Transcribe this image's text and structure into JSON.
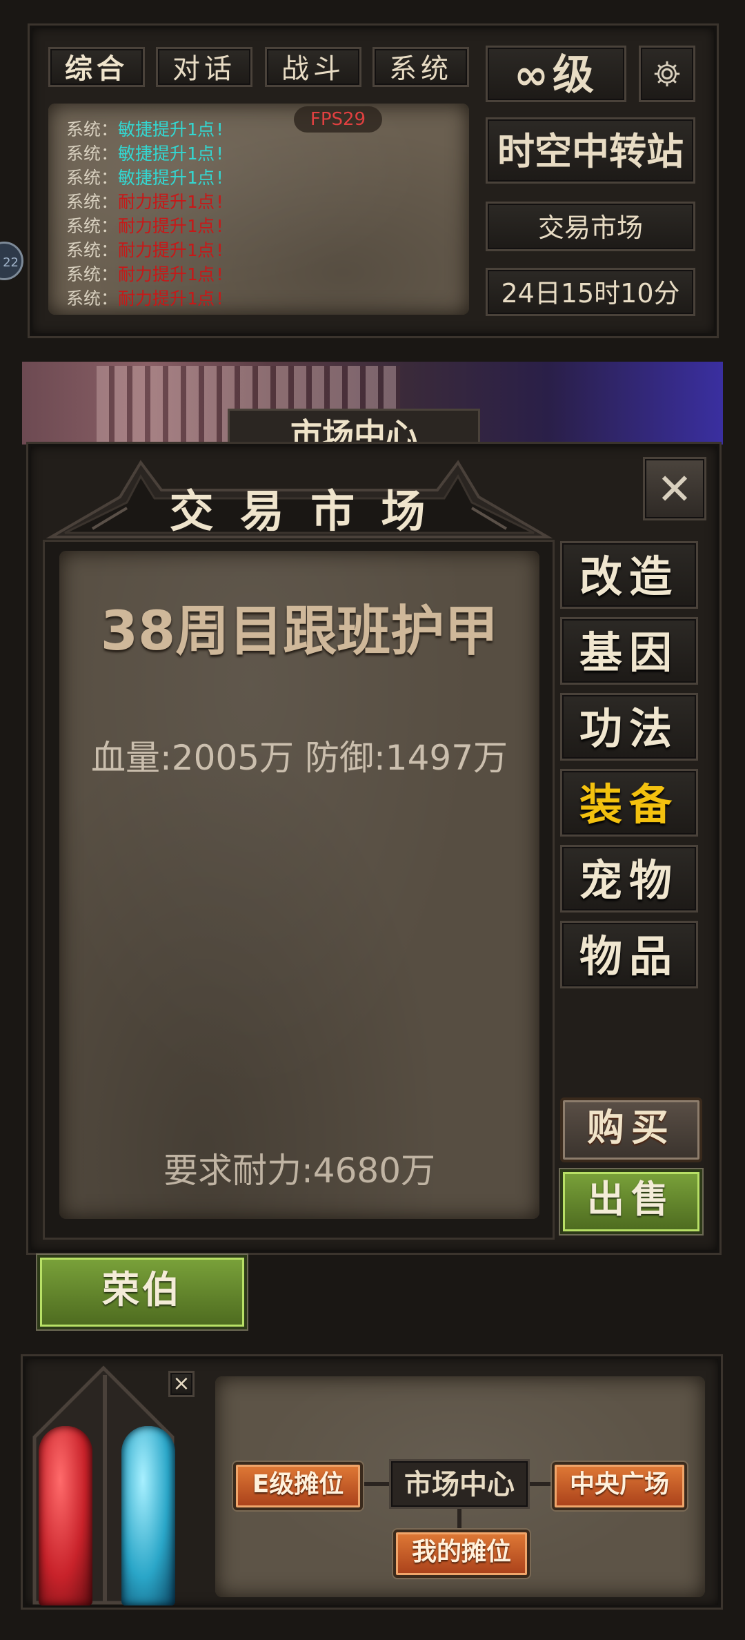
{
  "top_tabs": [
    "综合",
    "对话",
    "战斗",
    "系统"
  ],
  "level_label": "∞级",
  "fps": "FPS29",
  "chat_lines": [
    {
      "prefix": "系统：",
      "text": "敏捷提升1点!",
      "color": "cyan"
    },
    {
      "prefix": "系统：",
      "text": "敏捷提升1点!",
      "color": "cyan"
    },
    {
      "prefix": "系统：",
      "text": "敏捷提升1点!",
      "color": "cyan"
    },
    {
      "prefix": "系统：",
      "text": "耐力提升1点!",
      "color": "red"
    },
    {
      "prefix": "系统：",
      "text": "耐力提升1点!",
      "color": "red"
    },
    {
      "prefix": "系统：",
      "text": "耐力提升1点!",
      "color": "red"
    },
    {
      "prefix": "系统：",
      "text": "耐力提升1点!",
      "color": "red"
    },
    {
      "prefix": "系统：",
      "text": "耐力提升1点!",
      "color": "red"
    }
  ],
  "location_main": "时空中转站",
  "location_sub": "交易市场",
  "game_time": "24日15时10分",
  "side_badge": "22",
  "bg_banner": "市场中心",
  "dialog": {
    "title": "交 易 市 场",
    "close_label": "✕",
    "item_name": "38周目跟班护甲",
    "item_stats": "血量:2005万 防御:1497万",
    "requirement": "要求耐力:4680万",
    "categories": [
      {
        "label": "改造",
        "active": false
      },
      {
        "label": "基因",
        "active": false
      },
      {
        "label": "功法",
        "active": false
      },
      {
        "label": "装备",
        "active": true
      },
      {
        "label": "宠物",
        "active": false
      },
      {
        "label": "物品",
        "active": false
      }
    ],
    "buy_label": "购买",
    "sell_label": "出售"
  },
  "npc_button": "荣伯",
  "map": {
    "close_label": "×",
    "nodes": {
      "e_stall": "E级摊位",
      "market_center": "市场中心",
      "central_plaza": "中央广场",
      "my_stall": "我的摊位"
    }
  },
  "colors": {
    "accent_gold": "#f3c10f",
    "hp_red": "#c8222a",
    "mp_blue": "#2aa6c8"
  }
}
